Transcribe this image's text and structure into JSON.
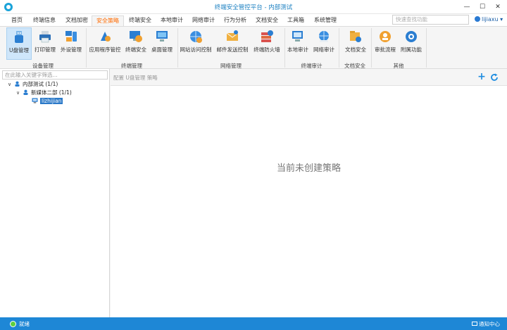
{
  "window": {
    "title": "终端安全管控平台 - 内部测试",
    "min_glyph": "—",
    "max_glyph": "☐",
    "close_glyph": "✕"
  },
  "menu": {
    "tabs": [
      {
        "label": "首页"
      },
      {
        "label": "终端信息"
      },
      {
        "label": "文档加密"
      },
      {
        "label": "安全策略",
        "active": true
      },
      {
        "label": "终端安全"
      },
      {
        "label": "本地审计"
      },
      {
        "label": "网络审计"
      },
      {
        "label": "行为分析"
      },
      {
        "label": "文档安全"
      },
      {
        "label": "工具箱"
      },
      {
        "label": "系统管理"
      }
    ],
    "search_placeholder": "快速查找功能",
    "user": "lijiaxu"
  },
  "ribbon": {
    "buttons": [
      {
        "label": "U盘管理",
        "icon": "usb-icon",
        "active": true
      },
      {
        "label": "打印管理",
        "icon": "printer-icon"
      },
      {
        "label": "外设管理",
        "icon": "peripheral-icon"
      },
      {
        "label": "应用程序管控",
        "icon": "app-control-icon"
      },
      {
        "label": "终端安全",
        "icon": "terminal-security-icon"
      },
      {
        "label": "桌面管理",
        "icon": "desktop-icon"
      },
      {
        "label": "网站访问控制",
        "icon": "globe-icon"
      },
      {
        "label": "邮件发送控制",
        "icon": "mail-icon"
      },
      {
        "label": "终端防火墙",
        "icon": "firewall-icon"
      },
      {
        "label": "本地审计",
        "icon": "local-audit-icon"
      },
      {
        "label": "网络审计",
        "icon": "network-audit-icon"
      },
      {
        "label": "文档安全",
        "icon": "doc-security-icon"
      },
      {
        "label": "审批流程",
        "icon": "approval-icon"
      },
      {
        "label": "附属功能",
        "icon": "gear-icon"
      }
    ],
    "groups": [
      {
        "label": "设备管理"
      },
      {
        "label": "终端管理"
      },
      {
        "label": "网络管理"
      },
      {
        "label": "终端审计"
      },
      {
        "label": "文档安全"
      },
      {
        "label": "其他"
      }
    ]
  },
  "tree": {
    "filter_placeholder": "在此输入关键字筛选...",
    "nodes": [
      {
        "label": "内部测试 (1/1)",
        "caret": "∨"
      },
      {
        "label": "新媒体二部 (1/1)",
        "caret": "∨"
      },
      {
        "label": "lizhijian",
        "caret": ""
      }
    ]
  },
  "content": {
    "breadcrumb": "配置 U盘管理 策略",
    "add_glyph": "+",
    "empty_message": "当前未创建策略"
  },
  "status": {
    "text": "就绪",
    "notify": "通知中心"
  },
  "colors": {
    "accent": "#1e87d6",
    "active_tab": "#ff6a00",
    "selected_node": "#2b79c8"
  }
}
